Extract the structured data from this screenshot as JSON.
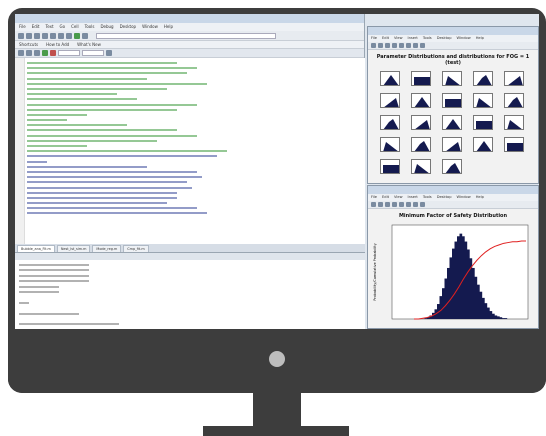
{
  "ide": {
    "menu": [
      "File",
      "Edit",
      "Text",
      "Go",
      "Cell",
      "Tools",
      "Debug",
      "Desktop",
      "Window",
      "Help"
    ],
    "shortcuts": [
      "Shortcuts",
      "How to Add",
      "What's New"
    ],
    "tabs": [
      "Bubble_ana_Fit.m",
      "Nest_lst_sim.m",
      "Mode_reg.m",
      "Cmp_fit.m"
    ]
  },
  "figure1": {
    "menu": [
      "File",
      "Edit",
      "View",
      "Insert",
      "Tools",
      "Desktop",
      "Window",
      "Help"
    ],
    "title": "Parameter Distributions and distributions for FOG = 1 (test)"
  },
  "figure2": {
    "menu": [
      "File",
      "Edit",
      "View",
      "Insert",
      "Tools",
      "Desktop",
      "Window",
      "Help"
    ],
    "title": "Minimum Factor of Safety Distribution",
    "y_label": "Probability/Cumulative Probability"
  },
  "chart_data": {
    "type": "bar",
    "title": "Minimum Factor of Safety Distribution",
    "ylabel": "Probability/Cumulative Probability",
    "xlim": [
      0,
      1
    ],
    "ylim": [
      0,
      1
    ],
    "series": [
      {
        "values": [
          0.0,
          0.01,
          0.02,
          0.04,
          0.07,
          0.11,
          0.17,
          0.26,
          0.35,
          0.46,
          0.58,
          0.7,
          0.8,
          0.88,
          0.94,
          0.97,
          0.94,
          0.88,
          0.79,
          0.69,
          0.58,
          0.48,
          0.39,
          0.31,
          0.24,
          0.18,
          0.13,
          0.09,
          0.06,
          0.04,
          0.03,
          0.02,
          0.01,
          0.01,
          0.0,
          0.0
        ]
      },
      {
        "values": [
          0.0,
          0.0,
          0.01,
          0.02,
          0.04,
          0.07,
          0.11,
          0.17,
          0.24,
          0.32,
          0.41,
          0.51,
          0.6,
          0.68,
          0.75,
          0.81,
          0.86,
          0.9,
          0.93,
          0.95,
          0.97,
          0.98,
          0.99,
          0.99,
          1.0,
          1.0
        ]
      }
    ]
  },
  "colors": {
    "bezel": "#3d3d3d",
    "histogram": "#141a4f",
    "cumulative_line": "#e02020",
    "code_comment": "#1d7a1d"
  }
}
